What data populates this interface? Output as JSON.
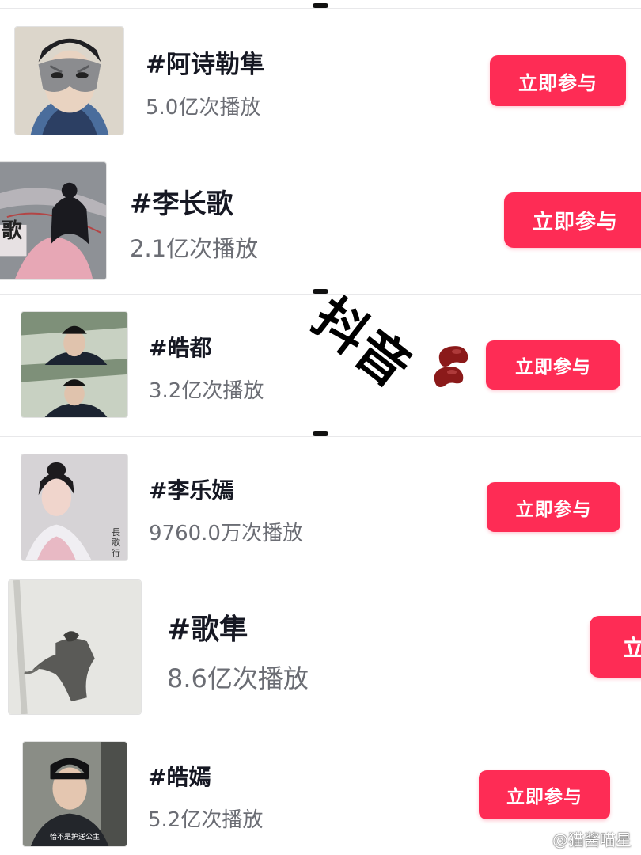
{
  "rows": [
    {
      "tag": "#阿诗勒隼",
      "views": "5.0亿次播放",
      "button": "立即参与",
      "thumb_icon": "masked-man-thumbnail"
    },
    {
      "tag": "#李长歌",
      "views": "2.1亿次播放",
      "button": "立即参与",
      "thumb_icon": "anime-girl-thumbnail",
      "thumb_caption": "歌"
    },
    {
      "tag": "#皓都",
      "views": "3.2亿次播放",
      "button": "立即参与",
      "thumb_icon": "guard-thumbnail"
    },
    {
      "tag": "#李乐嫣",
      "views": "9760.0万次播放",
      "button": "立即参与",
      "thumb_icon": "princess-thumbnail",
      "thumb_caption": "長歌行"
    },
    {
      "tag": "#歌隼",
      "views": "8.6亿次播放",
      "button": "立",
      "thumb_icon": "ink-painting-thumbnail"
    },
    {
      "tag": "#皓嫣",
      "views": "5.2亿次播放",
      "button": "立即参与",
      "thumb_icon": "official-thumbnail",
      "thumb_caption": "恰不是护送公主"
    }
  ],
  "sticker": {
    "text": "抖音",
    "icon": "kidney-beans-emoji"
  },
  "watermark": {
    "text": "@猫酱喵星",
    "icon": "weibo-logo-icon"
  },
  "colors": {
    "accent": "#fe2c55",
    "tag_text": "#161823",
    "views_text": "#6b6d74",
    "background": "#ffffff"
  }
}
